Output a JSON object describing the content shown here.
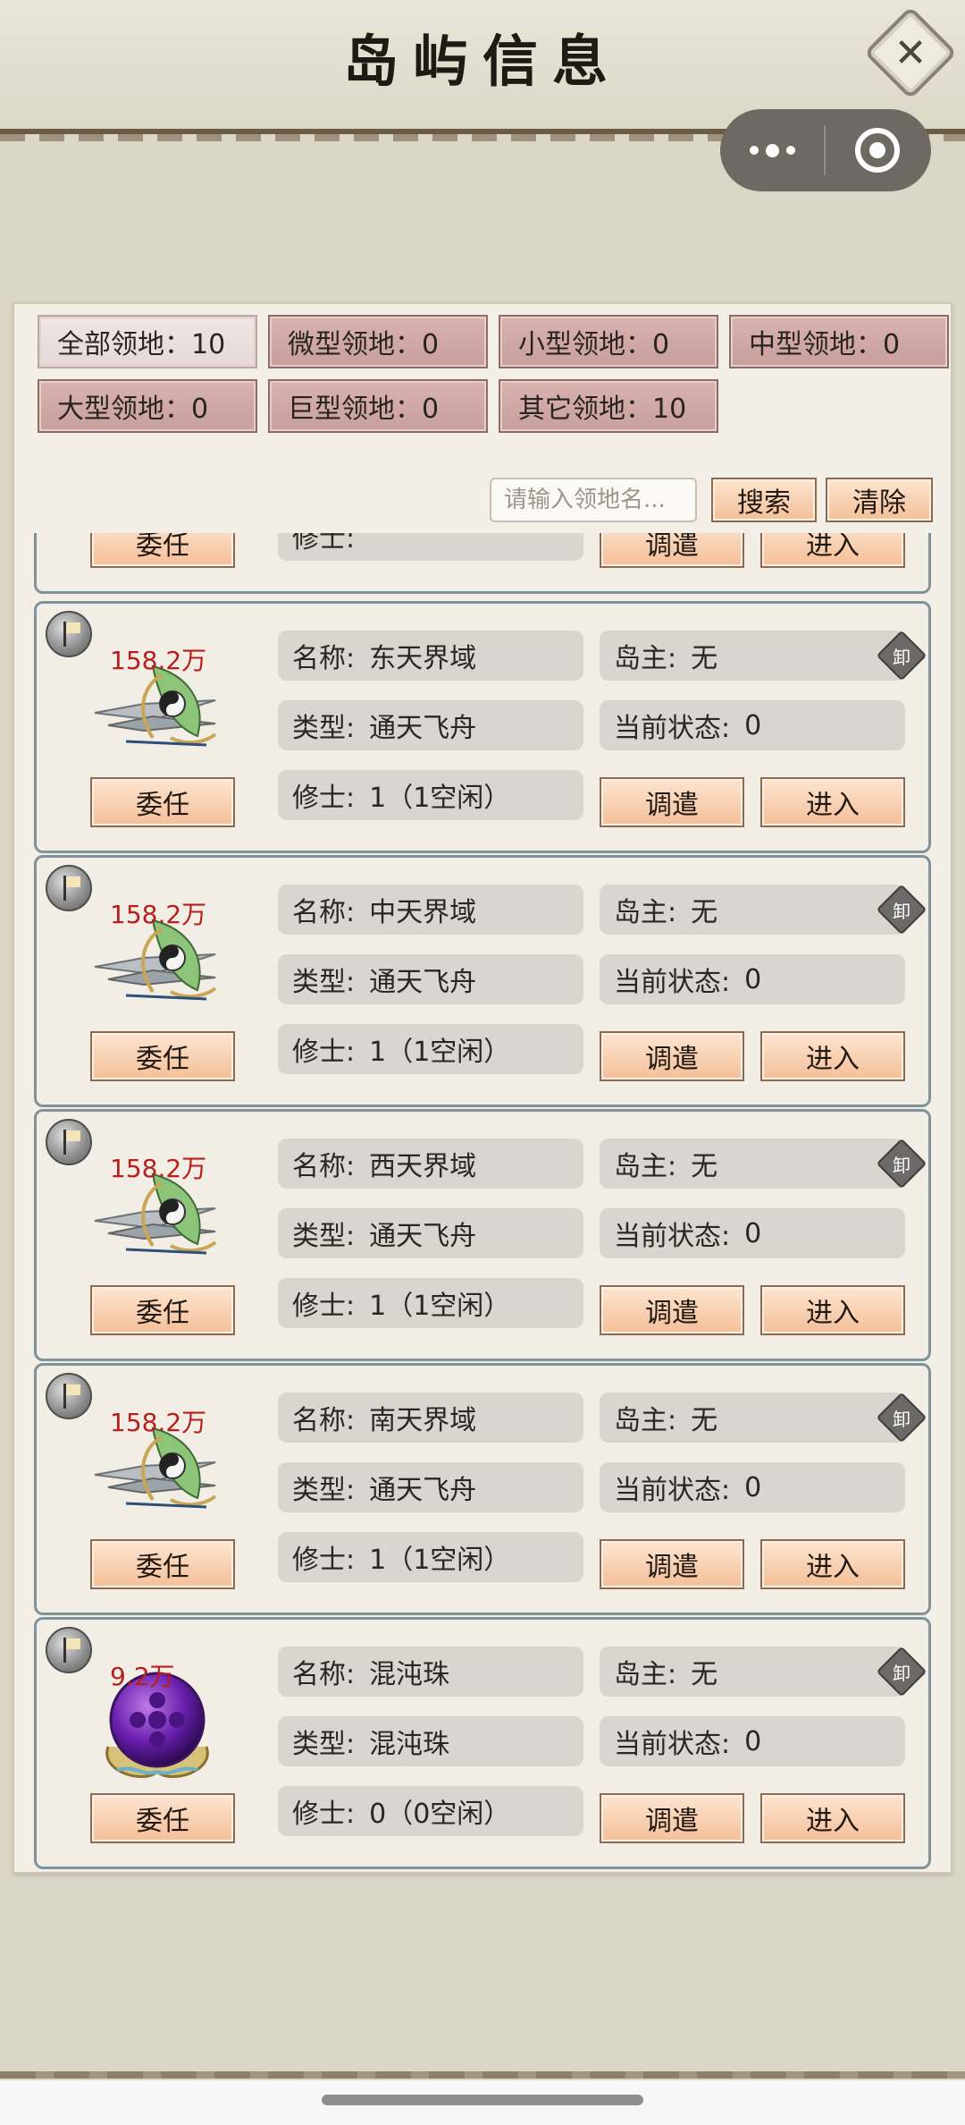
{
  "header": {
    "title": "岛屿信息",
    "close_symbol": "✕"
  },
  "filters": [
    {
      "label": "全部领地：10",
      "active": true
    },
    {
      "label": "微型领地：0",
      "active": false
    },
    {
      "label": "小型领地：0",
      "active": false
    },
    {
      "label": "中型领地：0",
      "active": false
    },
    {
      "label": "大型领地：0",
      "active": false
    },
    {
      "label": "巨型领地：0",
      "active": false
    },
    {
      "label": "其它领地：10",
      "active": false
    }
  ],
  "search": {
    "placeholder": "请输入领地名...",
    "search_label": "搜索",
    "clear_label": "清除"
  },
  "labels": {
    "name": "名称:",
    "owner": "岛主:",
    "type": "类型:",
    "state": "当前状态:",
    "staff": "修士:",
    "appoint": "委任",
    "dispatch": "调遣",
    "enter": "进入",
    "unload": "卸"
  },
  "cards": [
    {
      "power": "",
      "name": "",
      "owner": "",
      "type": "",
      "state": "",
      "staff": "",
      "art": "ship"
    },
    {
      "power": "158.2万",
      "name": "东天界域",
      "owner": "无",
      "type": "通天飞舟",
      "state": "0",
      "staff": "1（1空闲）",
      "art": "ship"
    },
    {
      "power": "158.2万",
      "name": "中天界域",
      "owner": "无",
      "type": "通天飞舟",
      "state": "0",
      "staff": "1（1空闲）",
      "art": "ship"
    },
    {
      "power": "158.2万",
      "name": "西天界域",
      "owner": "无",
      "type": "通天飞舟",
      "state": "0",
      "staff": "1（1空闲）",
      "art": "ship"
    },
    {
      "power": "158.2万",
      "name": "南天界域",
      "owner": "无",
      "type": "通天飞舟",
      "state": "0",
      "staff": "1（1空闲）",
      "art": "ship"
    },
    {
      "power": "9.2万",
      "name": "混沌珠",
      "owner": "无",
      "type": "混沌珠",
      "state": "0",
      "staff": "0（0空闲）",
      "art": "orb"
    }
  ],
  "colors": {
    "power_text": "#b6201c",
    "filter_bg": "#c79f9c",
    "button_bg": "#f4bf98",
    "card_border": "#7f939a"
  }
}
